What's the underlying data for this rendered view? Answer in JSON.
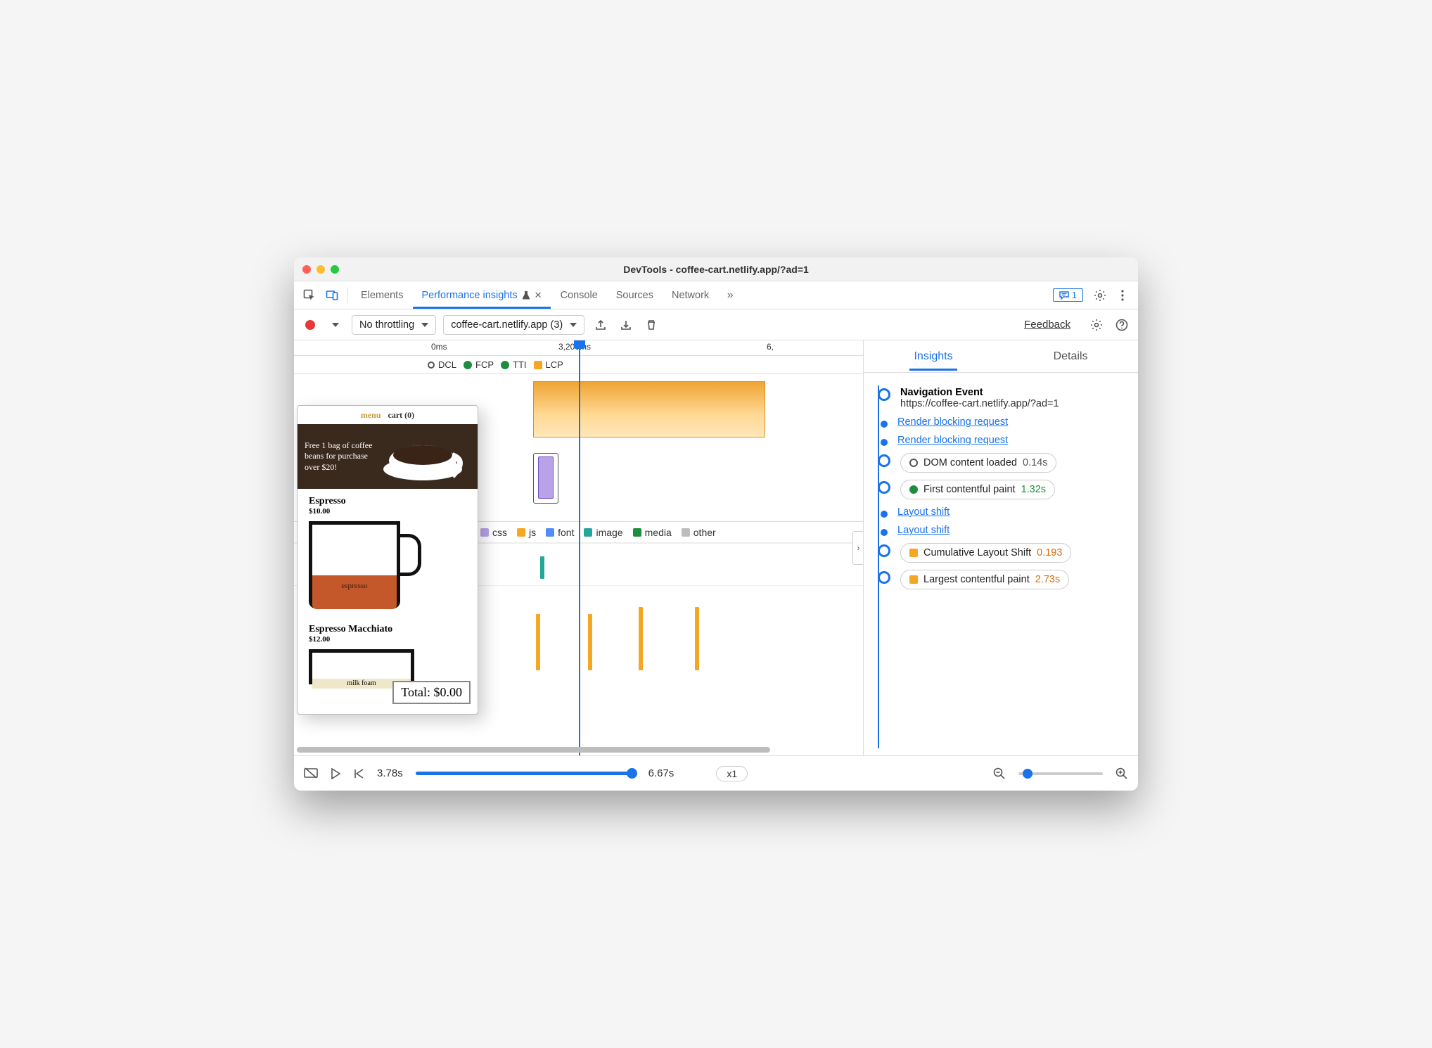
{
  "window": {
    "title": "DevTools - coffee-cart.netlify.app/?ad=1"
  },
  "tabs": {
    "elements": "Elements",
    "perf": "Performance insights",
    "console": "Console",
    "sources": "Sources",
    "network": "Network",
    "badge_count": "1"
  },
  "toolbar": {
    "throttling": "No throttling",
    "profile_select": "coffee-cart.netlify.app (3)",
    "feedback": "Feedback"
  },
  "ruler": {
    "t0": "0ms",
    "t1": "3,200ms",
    "t2": "6,"
  },
  "markers": {
    "dcl": "DCL",
    "fcp": "FCP",
    "tti": "TTI",
    "lcp": "LCP"
  },
  "legend": {
    "css": "css",
    "js": "js",
    "font": "font",
    "image": "image",
    "media": "media",
    "other": "other"
  },
  "preview": {
    "menu": "menu",
    "cart": "cart (0)",
    "hero": "Free 1 bag of coffee beans for purchase over $20!",
    "item1_name": "Espresso",
    "item1_price": "$10.00",
    "item1_fill": "espresso",
    "item2_name": "Espresso Macchiato",
    "item2_price": "$12.00",
    "item2_fill": "milk foam",
    "total": "Total: $0.00"
  },
  "right_tabs": {
    "insights": "Insights",
    "details": "Details"
  },
  "insights": {
    "nav_title": "Navigation Event",
    "nav_url": "https://coffee-cart.netlify.app/?ad=1",
    "rb1": "Render blocking request",
    "rb2": "Render blocking request",
    "dcl_label": "DOM content loaded",
    "dcl_val": "0.14s",
    "fcp_label": "First contentful paint",
    "fcp_val": "1.32s",
    "ls1": "Layout shift",
    "ls2": "Layout shift",
    "cls_label": "Cumulative Layout Shift",
    "cls_val": "0.193",
    "lcp_label": "Largest contentful paint",
    "lcp_val": "2.73s"
  },
  "footer": {
    "pos": "3.78s",
    "end": "6.67s",
    "zoom_label": "x1"
  },
  "colors": {
    "blue": "#1a73e8",
    "green": "#1e8e3e",
    "orange": "#f5a623",
    "orange_sq": "#f5a623",
    "purple": "#b9a2e8",
    "teal": "#26a69a",
    "gray": "#9e9e9e"
  }
}
